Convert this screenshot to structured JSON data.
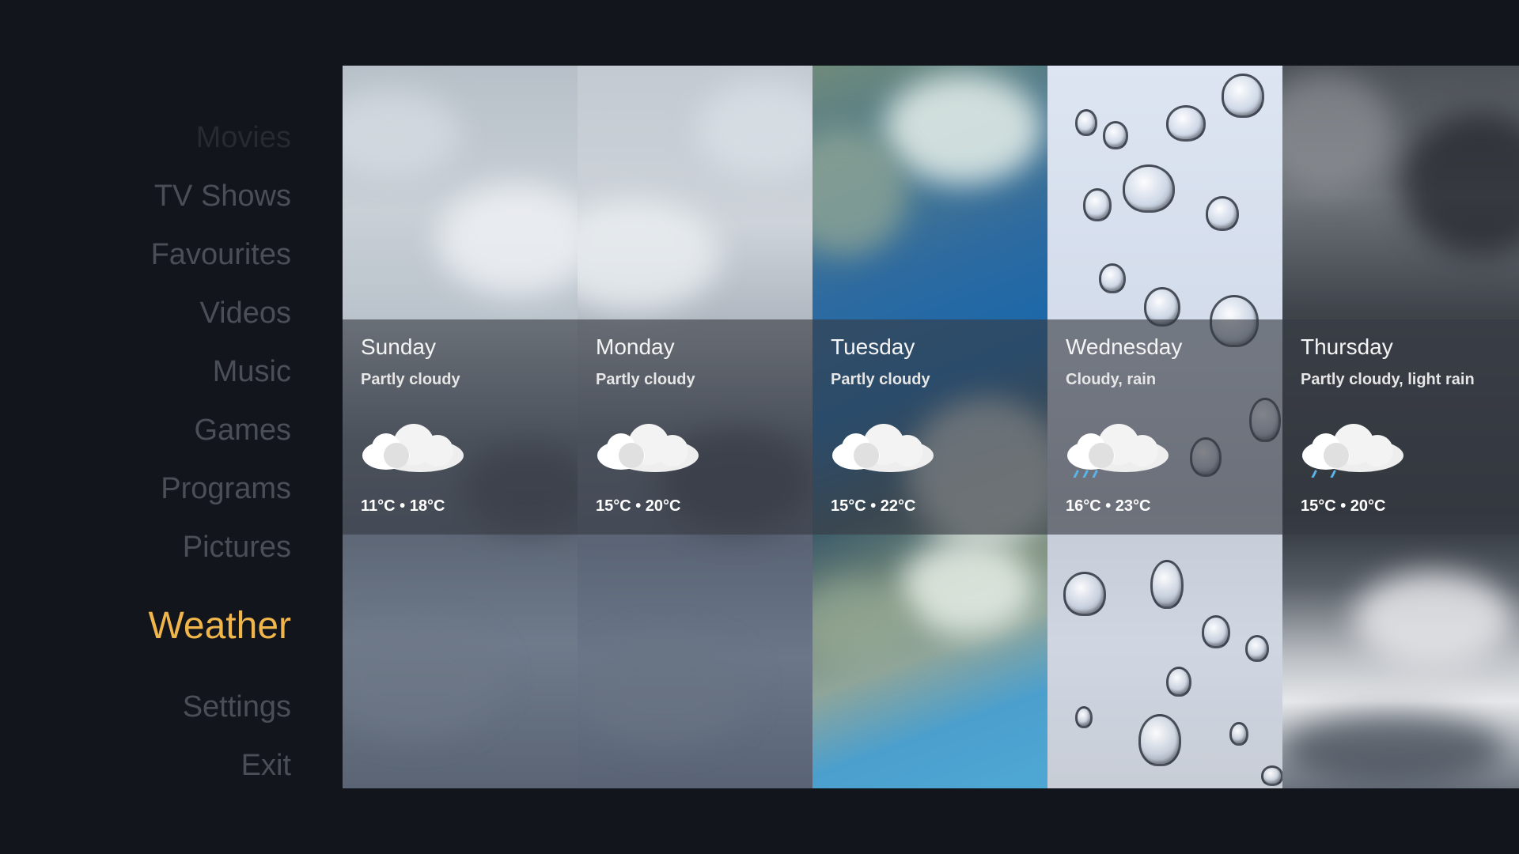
{
  "menu": {
    "items": [
      {
        "label": "Movies",
        "state": "faded"
      },
      {
        "label": "TV Shows",
        "state": "normal"
      },
      {
        "label": "Favourites",
        "state": "normal"
      },
      {
        "label": "Videos",
        "state": "normal"
      },
      {
        "label": "Music",
        "state": "normal"
      },
      {
        "label": "Games",
        "state": "normal"
      },
      {
        "label": "Programs",
        "state": "normal"
      },
      {
        "label": "Pictures",
        "state": "normal"
      },
      {
        "label": "Weather",
        "state": "active"
      },
      {
        "label": "Settings",
        "state": "normal"
      },
      {
        "label": "Exit",
        "state": "normal"
      }
    ]
  },
  "colors": {
    "background": "#12151b",
    "menu_text": "#4a4f57",
    "menu_active": "#f0b64b",
    "info_band": "rgba(55,58,66,0.62)",
    "rain": "#5ab4e8"
  },
  "forecast": [
    {
      "day": "Sunday",
      "condition": "Partly cloudy",
      "temperature": "11°C • 18°C",
      "icon": "partly-cloudy-icon",
      "backdrop": "overcast-sky"
    },
    {
      "day": "Monday",
      "condition": "Partly cloudy",
      "temperature": "15°C • 20°C",
      "icon": "partly-cloudy-icon",
      "backdrop": "overcast-sky"
    },
    {
      "day": "Tuesday",
      "condition": "Partly cloudy",
      "temperature": "15°C • 22°C",
      "icon": "partly-cloudy-icon",
      "backdrop": "blue-sky-clouds"
    },
    {
      "day": "Wednesday",
      "condition": "Cloudy, rain",
      "temperature": "16°C • 23°C",
      "icon": "cloudy-rain-icon",
      "backdrop": "raindrops-on-glass"
    },
    {
      "day": "Thursday",
      "condition": "Partly cloudy, light rain",
      "temperature": "15°C • 20°C",
      "icon": "light-rain-icon",
      "backdrop": "storm-clouds"
    }
  ]
}
